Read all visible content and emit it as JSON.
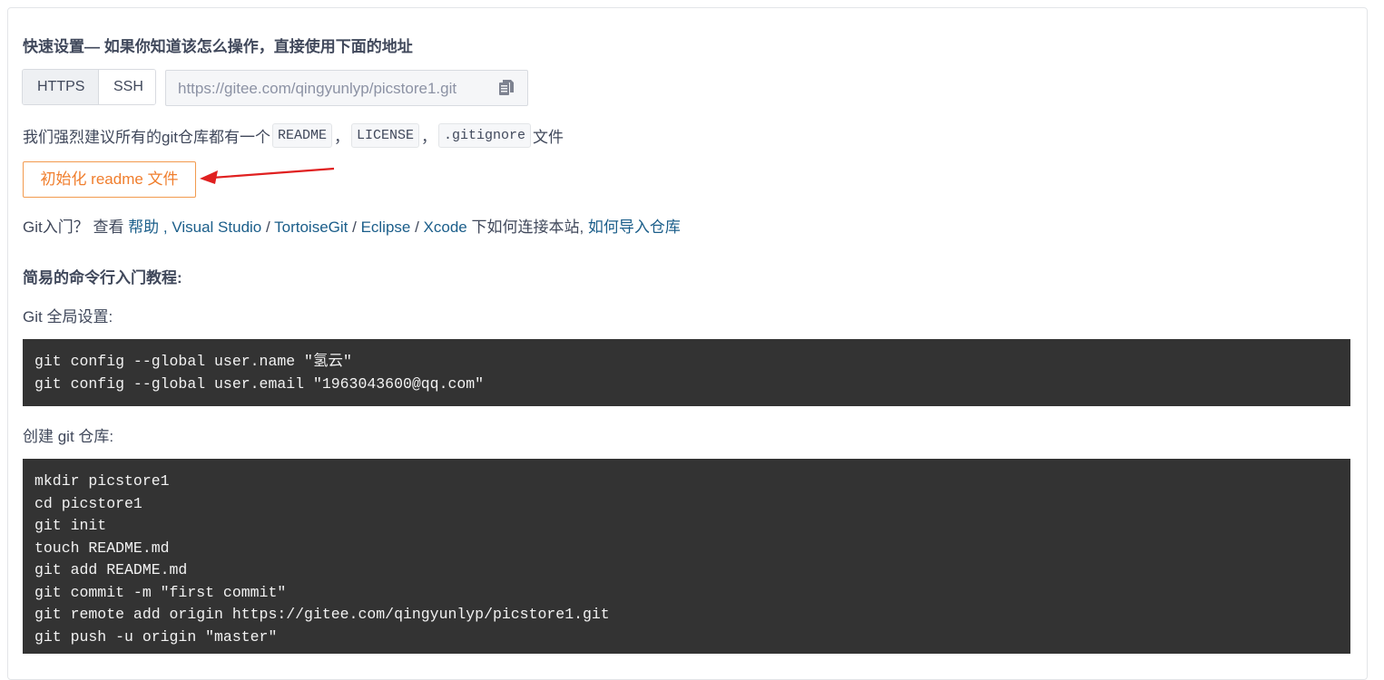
{
  "quick_setup": {
    "title": "快速设置— 如果你知道该怎么操作，直接使用下面的地址",
    "protocols": [
      "HTTPS",
      "SSH"
    ],
    "active_protocol": "HTTPS",
    "url": "https://gitee.com/qingyunlyp/picstore1.git"
  },
  "recommend": {
    "prefix": "我们强烈建议所有的git仓库都有一个",
    "files": [
      "README",
      "LICENSE",
      ".gitignore"
    ],
    "sep": "，",
    "suffix": "文件"
  },
  "init_button": "初始化 readme 文件",
  "help": {
    "prefix": "Git入门？ 查看 ",
    "link_help": "帮助",
    "link_vs": "Visual Studio",
    "link_tortoise": "TortoiseGit",
    "link_eclipse": "Eclipse",
    "link_xcode": "Xcode",
    "middle": " 下如何连接本站, ",
    "link_import": "如何导入仓库"
  },
  "tutorial": {
    "title": "简易的命令行入门教程:",
    "global_label": "Git 全局设置:",
    "global_commands": [
      "git config --global user.name \"氢云\"",
      "git config --global user.email \"1963043600@qq.com\""
    ],
    "create_label": "创建 git 仓库:",
    "create_commands": [
      "mkdir picstore1",
      "cd picstore1",
      "git init",
      "touch README.md",
      "git add README.md",
      "git commit -m \"first commit\"",
      "git remote add origin https://gitee.com/qingyunlyp/picstore1.git",
      "git push -u origin \"master\""
    ]
  },
  "colors": {
    "link": "#1b5e8a",
    "init_button": "#f07e2d",
    "arrow": "#e02020",
    "code_bg": "#333333"
  },
  "icons": {
    "copy": "copy-icon",
    "annotation": "red-arrow"
  }
}
